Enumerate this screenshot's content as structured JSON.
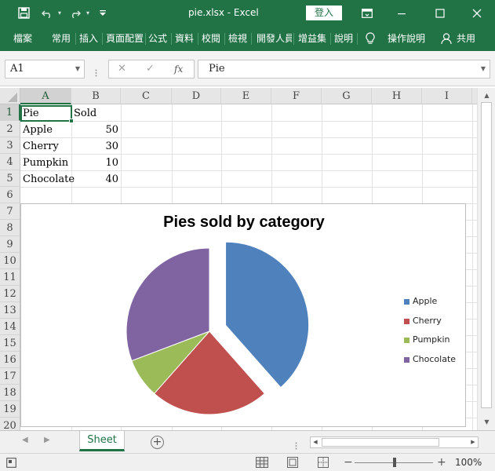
{
  "window": {
    "title": "pie.xlsx  -  Excel",
    "signin_label": "登入",
    "undo_icon": "undo-icon",
    "redo_icon": "redo-icon",
    "customize_icon": "chevron-down-icon"
  },
  "ribbon": {
    "tabs": [
      "檔案",
      "常用",
      "插入",
      "頁面配置",
      "公式",
      "資料",
      "校閱",
      "檢視",
      "開發人員",
      "增益集",
      "說明"
    ],
    "tell_me": "操作說明",
    "share": "共用"
  },
  "formula_bar": {
    "name_box": "A1",
    "cancel_icon": "✕",
    "enter_icon": "✓",
    "fx_label": "fx",
    "content": "Pie"
  },
  "sheet": {
    "columns": [
      "A",
      "B",
      "C",
      "D",
      "E",
      "F",
      "G",
      "H",
      "I"
    ],
    "rows": [
      "1",
      "2",
      "3",
      "4",
      "5",
      "6",
      "7",
      "8",
      "9",
      "10",
      "11",
      "12",
      "13",
      "14",
      "15",
      "16",
      "17",
      "18",
      "19",
      "20"
    ],
    "cells": {
      "A1": "Pie",
      "B1": "Sold",
      "A2": "Apple",
      "B2": "50",
      "A3": "Cherry",
      "B3": "30",
      "A4": "Pumpkin",
      "B4": "10",
      "A5": "Chocolate",
      "B5": "40"
    },
    "selected_cell": "A1"
  },
  "chart_data": {
    "type": "pie",
    "title": "Pies sold by category",
    "categories": [
      "Apple",
      "Cherry",
      "Pumpkin",
      "Chocolate"
    ],
    "values": [
      50,
      30,
      10,
      40
    ],
    "colors": [
      "#4f81bd",
      "#c0504d",
      "#9bbb59",
      "#8064a2"
    ],
    "exploded": [
      "Apple"
    ],
    "legend": "right"
  },
  "tabs": {
    "active_sheet": "Sheet",
    "add_label": "+"
  },
  "status": {
    "zoom": "100%",
    "zoom_minus": "−",
    "zoom_plus": "+"
  }
}
